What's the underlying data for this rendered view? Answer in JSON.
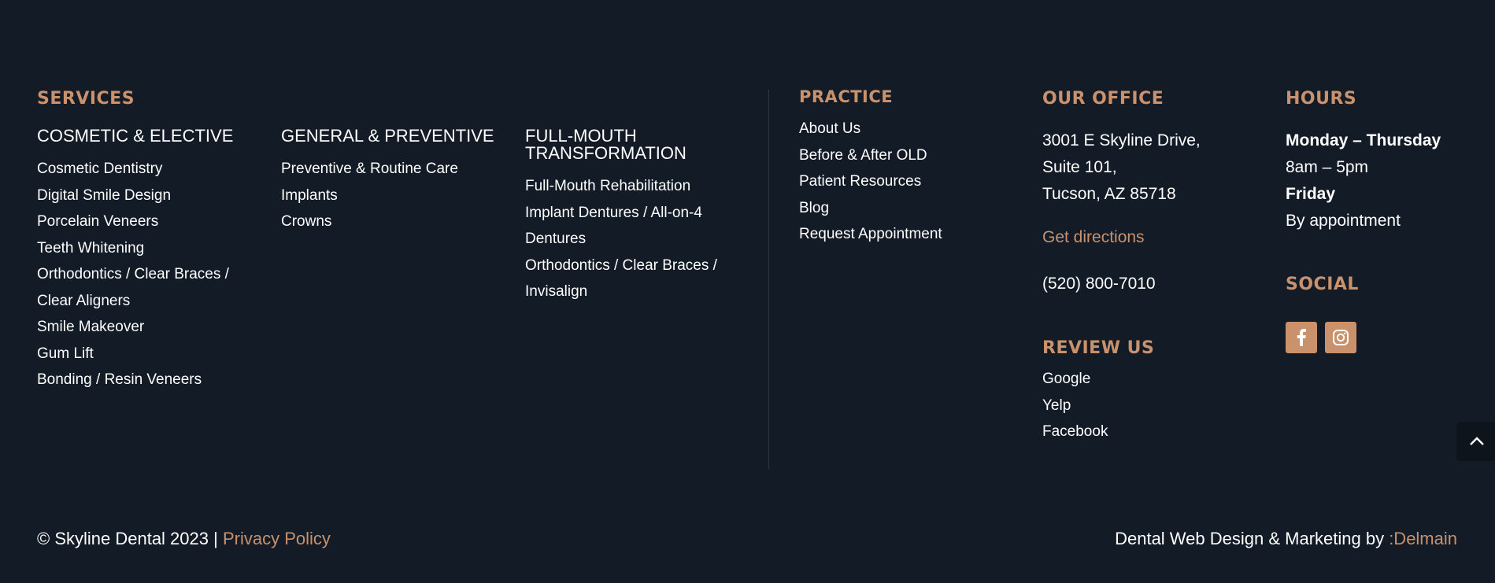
{
  "services": {
    "heading": "SERVICES",
    "cosmetic": {
      "title": "COSMETIC & ELECTIVE",
      "items": [
        "Cosmetic Dentistry",
        "Digital Smile Design",
        "Porcelain Veneers",
        "Teeth Whitening",
        "Orthodontics / Clear Braces /",
        "Clear Aligners",
        "Smile Makeover",
        "Gum Lift",
        "Bonding / Resin Veneers"
      ]
    },
    "general": {
      "title": "GENERAL & PREVENTIVE",
      "items": [
        "Preventive & Routine Care",
        "Implants",
        "Crowns"
      ]
    },
    "fullmouth": {
      "title_line1": "FULL-MOUTH",
      "title_line2": "TRANSFORMATION",
      "items": [
        "Full-Mouth Rehabilitation",
        "Implant Dentures / All-on-4",
        "Dentures",
        "Orthodontics / Clear Braces /",
        "Invisalign"
      ]
    }
  },
  "practice": {
    "heading": "PRACTICE",
    "items": [
      "About Us",
      "Before & After OLD",
      "Patient Resources",
      "Blog",
      "Request Appointment"
    ]
  },
  "office": {
    "heading": "OUR OFFICE",
    "address_line1": "3001 E Skyline Drive,",
    "address_line2": "Suite 101,",
    "address_line3": "Tucson, AZ 85718",
    "directions_label": "Get directions",
    "phone": "(520) 800-7010"
  },
  "review": {
    "heading": "REVIEW US",
    "items": [
      "Google",
      "Yelp",
      "Facebook"
    ]
  },
  "hours": {
    "heading": "HOURS",
    "day1": "Monday – Thursday",
    "time1": "8am – 5pm",
    "day2": "Friday",
    "time2": "By appointment"
  },
  "social": {
    "heading": "SOCIAL",
    "icons": [
      "facebook-icon",
      "instagram-icon"
    ]
  },
  "footer": {
    "copyright": "© Skyline Dental 2023 | ",
    "privacy_label": "Privacy Policy",
    "credit": "Dental Web Design & Marketing by ",
    "credit_link": ":Delmain"
  },
  "colors": {
    "background": "#121b26",
    "accent": "#c9916c",
    "text": "#ffffff"
  }
}
